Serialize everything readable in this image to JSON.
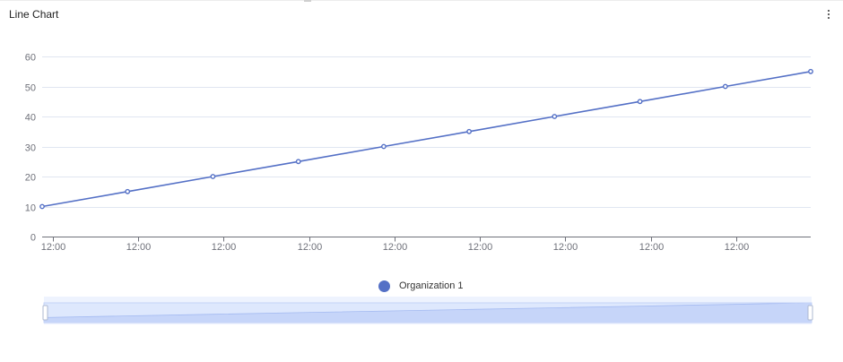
{
  "widget": {
    "title": "Line Chart"
  },
  "colors": {
    "series": "#5470c6",
    "grid": "#e0e6f1",
    "axis": "#6e7079",
    "zoom_fill": "#e4ecfd",
    "zoom_area": "#d2dcfa"
  },
  "icons": {
    "menu": "more-vertical-icon"
  },
  "chart_data": {
    "type": "line",
    "title": "",
    "xlabel": "",
    "ylabel": "",
    "x": [
      "12:00",
      "12:00",
      "12:00",
      "12:00",
      "12:00",
      "12:00",
      "12:00",
      "12:00",
      "12:00",
      "12:00"
    ],
    "x_tick_labels": [
      "12:00",
      "12:00",
      "12:00",
      "12:00",
      "12:00",
      "12:00",
      "12:00",
      "12:00",
      "12:00"
    ],
    "ylim": [
      0,
      60
    ],
    "y_ticks": [
      0,
      10,
      20,
      30,
      40,
      50,
      60
    ],
    "grid": true,
    "legend_position": "bottom-center",
    "series": [
      {
        "name": "Organization 1",
        "values": [
          10,
          15,
          20,
          25,
          30,
          35,
          40,
          45,
          50,
          55
        ]
      }
    ],
    "data_zoom": {
      "start_percent": 0,
      "end_percent": 100
    }
  }
}
